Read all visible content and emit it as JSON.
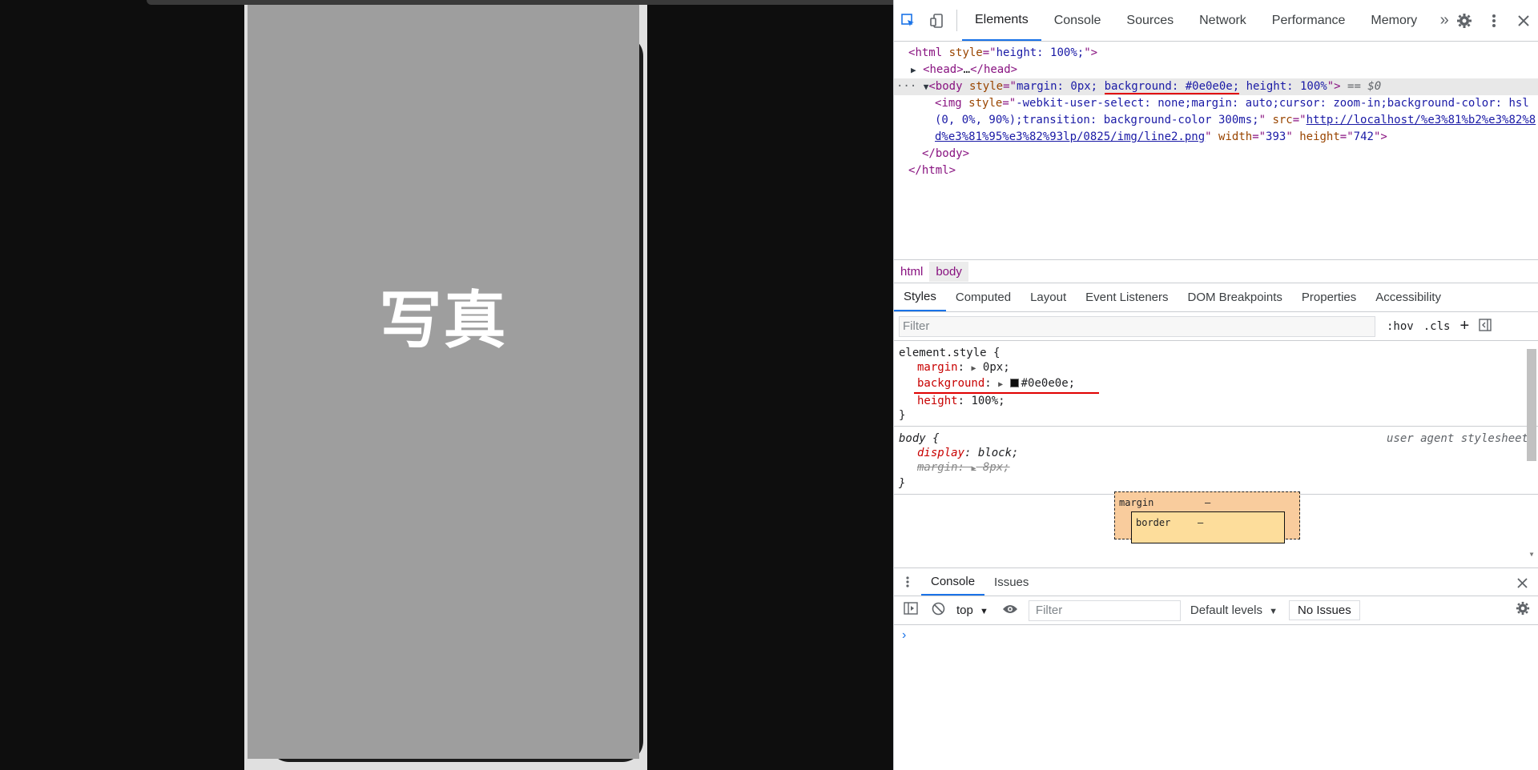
{
  "viewport": {
    "photo_label": "写真",
    "page_background": "#0e0e0e",
    "image_placeholder_color": "#9e9e9e"
  },
  "devtools": {
    "tabs": [
      "Elements",
      "Console",
      "Sources",
      "Network",
      "Performance",
      "Memory"
    ],
    "active_tab": "Elements",
    "more_tabs_icon": "double-chevron-icon",
    "dom": {
      "html_open_tag": "html",
      "html_style_attr": "style",
      "html_style_val": "height: 100%;",
      "head_text": "head",
      "head_ellipsis": "…",
      "body_tag": "body",
      "body_style_a": "margin: 0px;",
      "body_style_b": "background: #0e0e0e;",
      "body_style_c": "height: 100%",
      "dollar_zero": "== $0",
      "img_tag": "img",
      "img_style_line1": "-webkit-user-select: none;margin: auto;cursor: zoom-in;background-color: hsl",
      "img_style_line2": "(0, 0%, 90%);transition: background-color 300ms;",
      "img_src_attr": "src",
      "img_src_part1": "http://localhost/%e3%81%b2%e3%82%8",
      "img_src_part2": "d%e3%81%95%e3%82%93lp/0825/img/line2.png",
      "img_width_attr": "width",
      "img_width_val": "393",
      "img_height_attr": "height",
      "img_height_val": "742",
      "body_close": "</body>",
      "html_close": "</html>"
    },
    "breadcrumb": [
      "html",
      "body"
    ],
    "styles_tabs": [
      "Styles",
      "Computed",
      "Layout",
      "Event Listeners",
      "DOM Breakpoints",
      "Properties",
      "Accessibility"
    ],
    "filter_placeholder": "Filter",
    "hov_label": ":hov",
    "cls_label": ".cls",
    "element_style": {
      "selector": "element.style {",
      "props": [
        {
          "name": "margin",
          "value": "0px;"
        },
        {
          "name": "background",
          "value": "#0e0e0e;"
        },
        {
          "name": "height",
          "value": "100%;"
        }
      ],
      "close": "}"
    },
    "body_rule": {
      "selector": "body {",
      "source": "user agent stylesheet",
      "props": [
        {
          "name": "display",
          "value": "block;"
        },
        {
          "name": "margin",
          "value": "8px;"
        }
      ],
      "close": "}"
    },
    "box_model": {
      "margin_label": "margin",
      "margin_val": "–",
      "border_label": "border",
      "border_val": "–"
    },
    "drawer": {
      "tabs": [
        "Console",
        "Issues"
      ],
      "context": "top",
      "filter_placeholder": "Filter",
      "levels": "Default levels",
      "issues_button": "No Issues",
      "prompt": "›"
    }
  }
}
